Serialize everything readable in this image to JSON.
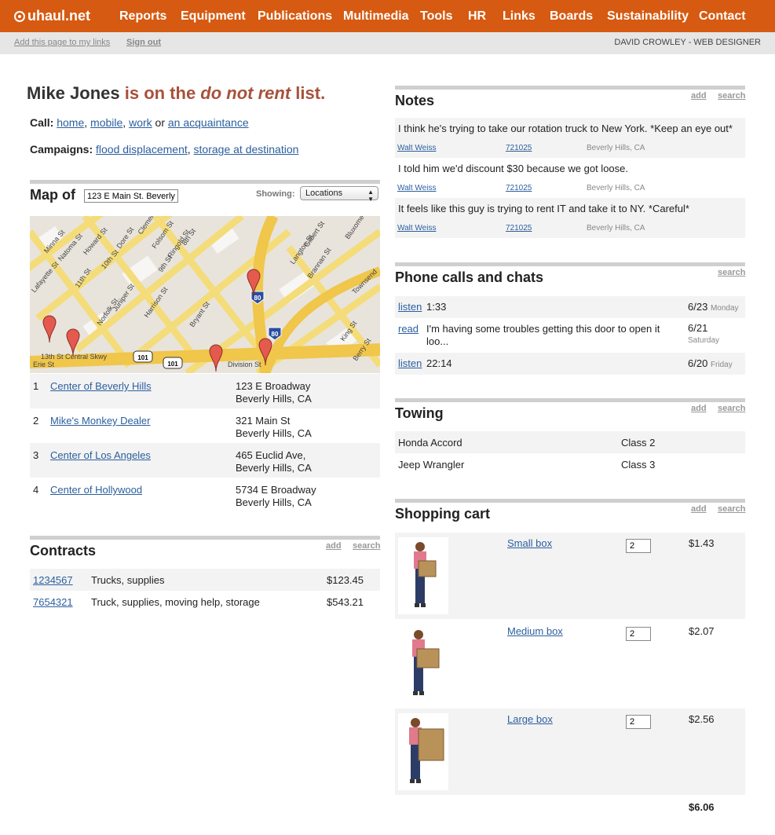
{
  "nav": {
    "logo": "uhaul.net",
    "items": [
      "Reports",
      "Equipment",
      "Publications",
      "Multimedia",
      "Tools",
      "HR",
      "Links",
      "Boards",
      "Sustainability",
      "Contact"
    ]
  },
  "subbar": {
    "add_link": "Add this page to my links",
    "signout": "Sign out",
    "user": "DAVID CROWLEY - WEB DESIGNER"
  },
  "customer": {
    "name": "Mike Jones",
    "status_pre": "is on the ",
    "status_em": "do not rent",
    "status_post": " list.",
    "call_label": "Call:",
    "call_home": "home",
    "call_mobile": "mobile",
    "call_work": "work",
    "call_or": "or",
    "call_acq": "an acquaintance",
    "camp_label": "Campaigns:",
    "camp1": "flood displacement",
    "camp2": "storage at destination"
  },
  "map": {
    "heading": "Map of",
    "address_value": "123 E Main St. Beverly",
    "showing_label": "Showing:",
    "showing_value": "Locations",
    "street_labels": [
      "Minna St",
      "Natoma St",
      "Howard St",
      "10th St",
      "Dore St",
      "Folsom St",
      "Ringold St",
      "9th St",
      "8th St",
      "Lafayette St",
      "11th St",
      "Juniper St",
      "Harrison St",
      "Bryant St",
      "Norfolk St",
      "Langton St",
      "Brannan St",
      "Gilbert St",
      "Townsend",
      "King St",
      "Berry St",
      "13th St Central Skwy",
      "Erie St",
      "Division St",
      "Clementina St",
      "Bluxome St"
    ],
    "shields": [
      "101",
      "101",
      "80",
      "80"
    ]
  },
  "locations": [
    {
      "num": "1",
      "name": "Center of Beverly Hills",
      "addr1": "123 E Broadway",
      "addr2": "Beverly Hills, CA"
    },
    {
      "num": "2",
      "name": "Mike's Monkey Dealer",
      "addr1": "321 Main St",
      "addr2": "Beverly Hills, CA"
    },
    {
      "num": "3",
      "name": "Center of Los Angeles",
      "addr1": "465 Euclid Ave,",
      "addr2": "Beverly Hills, CA"
    },
    {
      "num": "4",
      "name": "Center of Hollywood",
      "addr1": "5734 E Broadway",
      "addr2": "Beverly Hills, CA"
    }
  ],
  "contracts": {
    "heading": "Contracts",
    "add": "add",
    "search": "search",
    "rows": [
      {
        "id": "1234567",
        "desc": "Trucks, supplies",
        "amount": "$123.45"
      },
      {
        "id": "7654321",
        "desc": "Truck, supplies, moving help, storage",
        "amount": "$543.21"
      }
    ]
  },
  "notes": {
    "heading": "Notes",
    "add": "add",
    "search": "search",
    "items": [
      {
        "text": "I think he's trying to take our rotation truck to New York. *Keep an eye out*",
        "author": "Walt Weiss",
        "ref": "721025",
        "place": "Beverly Hills, CA"
      },
      {
        "text": "I told him we'd discount $30 because we got loose.",
        "author": "Walt Weiss",
        "ref": "721025",
        "place": "Beverly Hills, CA"
      },
      {
        "text": "It feels like this guy is trying to rent IT and take it to NY. *Careful*",
        "author": "Walt Weiss",
        "ref": "721025",
        "place": "Beverly Hills, CA"
      }
    ]
  },
  "calls": {
    "heading": "Phone calls and chats",
    "search": "search",
    "items": [
      {
        "action": "listen",
        "value": "1:33",
        "date": "6/23",
        "day": "Monday"
      },
      {
        "action": "read",
        "value": "I'm having some troubles getting this door to open it loo...",
        "date": "6/21",
        "day": "Saturday"
      },
      {
        "action": "listen",
        "value": "22:14",
        "date": "6/20",
        "day": "Friday"
      }
    ]
  },
  "towing": {
    "heading": "Towing",
    "add": "add",
    "search": "search",
    "rows": [
      {
        "vehicle": "Honda Accord",
        "class": "Class 2"
      },
      {
        "vehicle": "Jeep Wrangler",
        "class": "Class 3"
      }
    ]
  },
  "cart": {
    "heading": "Shopping cart",
    "add": "add",
    "search": "search",
    "items": [
      {
        "name": "Small box",
        "qty": "2",
        "price": "$1.43"
      },
      {
        "name": "Medium box",
        "qty": "2",
        "price": "$2.07"
      },
      {
        "name": "Large box",
        "qty": "2",
        "price": "$2.56"
      }
    ],
    "total": "$6.06"
  },
  "colors": {
    "brand": "#d65a11",
    "status": "#a8513b",
    "link": "#2b5f9e"
  }
}
